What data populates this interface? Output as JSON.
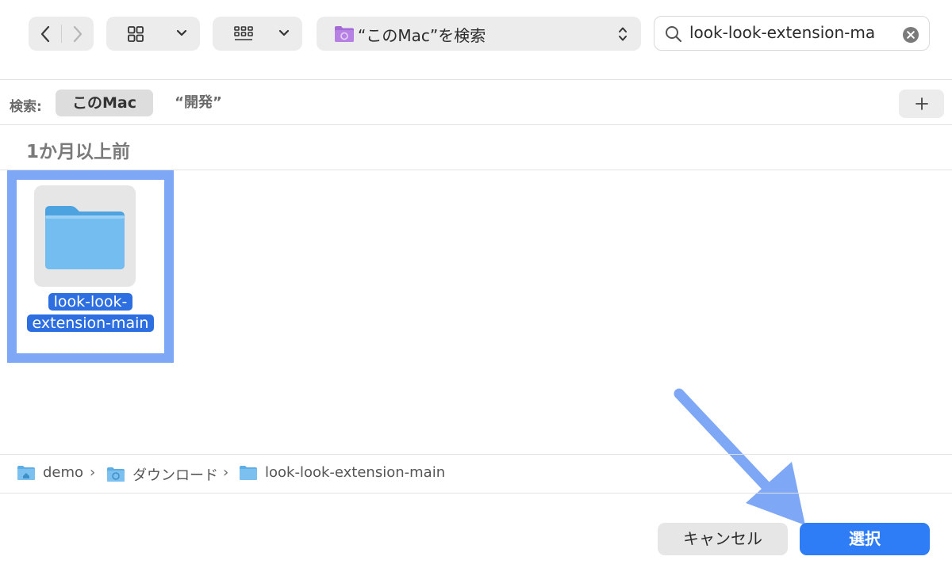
{
  "toolbar": {
    "scope_label": "“このMac”を検索",
    "search_value": "look-look-extension-ma"
  },
  "scopebar": {
    "label": "検索:",
    "scope_this_mac": "このMac",
    "scope_folder": "“開発”"
  },
  "section": {
    "title": "1か月以上前"
  },
  "items": [
    {
      "name_line1": "look-look-",
      "name_line2": "extension-main",
      "selected": true
    }
  ],
  "pathbar": {
    "crumbs": [
      "demo",
      "ダウンロード",
      "look-look-extension-main"
    ]
  },
  "buttons": {
    "cancel": "キャンセル",
    "ok": "選択"
  },
  "colors": {
    "accent": "#2f7df6",
    "selection": "#2d6fe0",
    "highlight_frame": "#7ea7f5",
    "folder": "#6ab8ef",
    "scope_folder_icon": "#a46ad6"
  },
  "icons": [
    "chevron-left-icon",
    "chevron-right-icon",
    "grid-view-icon",
    "gallery-view-icon",
    "chevron-down-icon",
    "folder-icon",
    "up-down-icon",
    "search-icon",
    "clear-icon",
    "plus-icon",
    "arrow-icon"
  ]
}
